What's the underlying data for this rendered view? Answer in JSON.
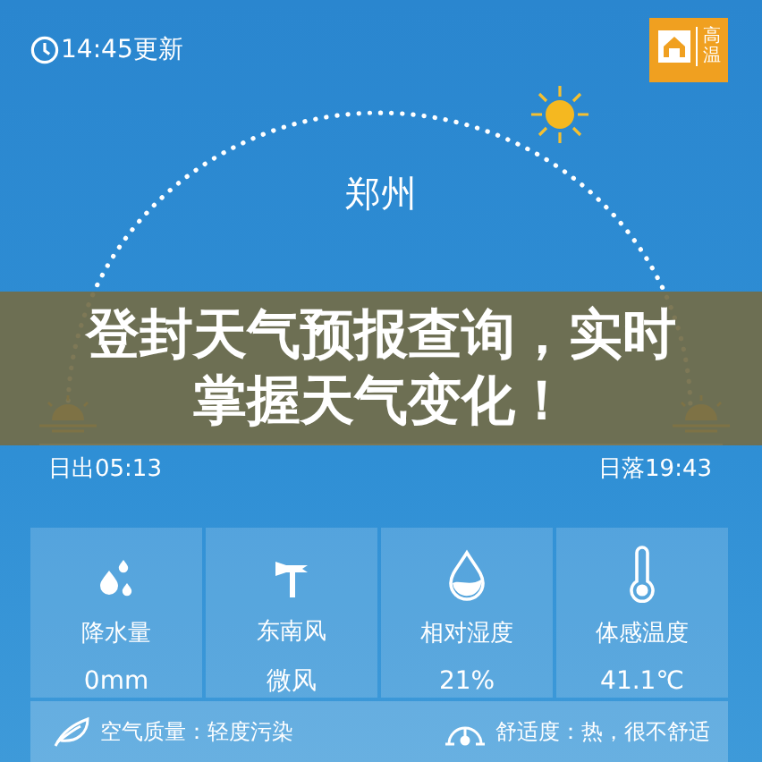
{
  "updated": "14:45更新",
  "warning": {
    "label": "高温"
  },
  "city": "郑州",
  "sunrise": "日出05:13",
  "sunset": "日落19:43",
  "banner": "登封天气预报查询，实时掌握天气变化！",
  "metrics": [
    {
      "kind": "rain",
      "label": "降水量",
      "value": "0mm"
    },
    {
      "kind": "wind",
      "label": "东南风",
      "value": "微风"
    },
    {
      "kind": "humidity",
      "label": "相对湿度",
      "value": "21%"
    },
    {
      "kind": "feels",
      "label": "体感温度",
      "value": "41.1℃"
    }
  ],
  "footer": [
    {
      "kind": "air",
      "text": "空气质量：轻度污染"
    },
    {
      "kind": "comfort",
      "text": "舒适度：热，很不舒适"
    }
  ]
}
